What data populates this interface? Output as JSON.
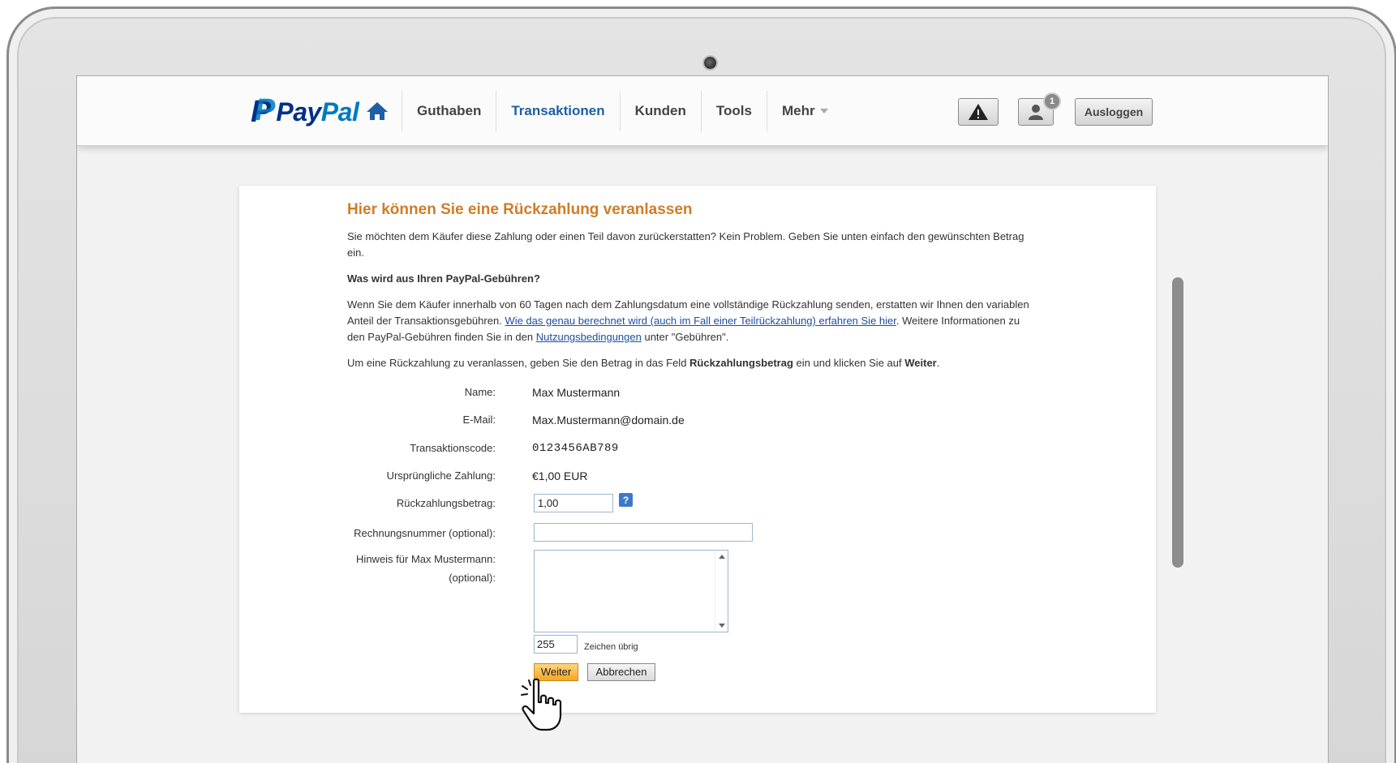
{
  "header": {
    "logo_text_1": "Pay",
    "logo_text_2": "Pal",
    "nav": [
      {
        "label": "Guthaben",
        "active": false
      },
      {
        "label": "Transaktionen",
        "active": true
      },
      {
        "label": "Kunden",
        "active": false
      },
      {
        "label": "Tools",
        "active": false
      },
      {
        "label": "Mehr",
        "active": false
      }
    ],
    "notification_count": "1",
    "logout_label": "Ausloggen",
    "icons": {
      "home": "home-icon",
      "alert": "warning-icon",
      "user": "user-icon"
    }
  },
  "content": {
    "title": "Hier können Sie eine Rückzahlung veranlassen",
    "intro": "Sie möchten dem Käufer diese Zahlung oder einen Teil davon zurückerstatten? Kein Problem. Geben Sie unten einfach den gewünschten Betrag ein.",
    "fees_heading": "Was wird aus Ihren PayPal-Gebühren?",
    "fees_text_1": "Wenn Sie dem Käufer innerhalb von 60 Tagen nach dem Zahlungsdatum eine vollständige Rückzahlung senden, erstatten wir Ihnen den variablen Anteil der Transaktionsgebühren.",
    "fees_link_1": "Wie das genau berechnet wird (auch im Fall einer Teilrückzahlung) erfahren Sie hier",
    "fees_text_2": ". Weitere Informationen zu den PayPal-Gebühren finden Sie in den",
    "fees_link_2": "Nutzungsbedingungen",
    "fees_text_3": "unter \"Gebühren\".",
    "instr_text_1": "Um eine Rückzahlung zu veranlassen, geben Sie den Betrag in das Feld",
    "instr_bold_1": "Rückzahlungsbetrag",
    "instr_text_2": "ein und klicken Sie auf",
    "instr_bold_2": "Weiter",
    "instr_text_3": "."
  },
  "form": {
    "name_label": "Name:",
    "name_value": "Max Mustermann",
    "email_label": "E-Mail:",
    "email_value": "Max.Mustermann@domain.de",
    "txn_label": "Transaktionscode:",
    "txn_value": "0123456AB789",
    "orig_label": "Ursprüngliche Zahlung:",
    "orig_value": "€1,00 EUR",
    "refund_label": "Rückzahlungsbetrag:",
    "refund_value": "1,00",
    "help_glyph": "?",
    "invoice_label": "Rechnungsnummer (optional):",
    "invoice_value": "",
    "note_label_1": "Hinweis für Max Mustermann:",
    "note_label_2": "(optional):",
    "note_value": "",
    "chars_left": "255",
    "chars_label": "Zeichen übrig",
    "continue_label": "Weiter",
    "cancel_label": "Abbrechen"
  },
  "colors": {
    "title": "#d07c27",
    "active_nav": "#1e5fa6",
    "link": "#1d4fa0",
    "primary_button": "#f5a623"
  }
}
